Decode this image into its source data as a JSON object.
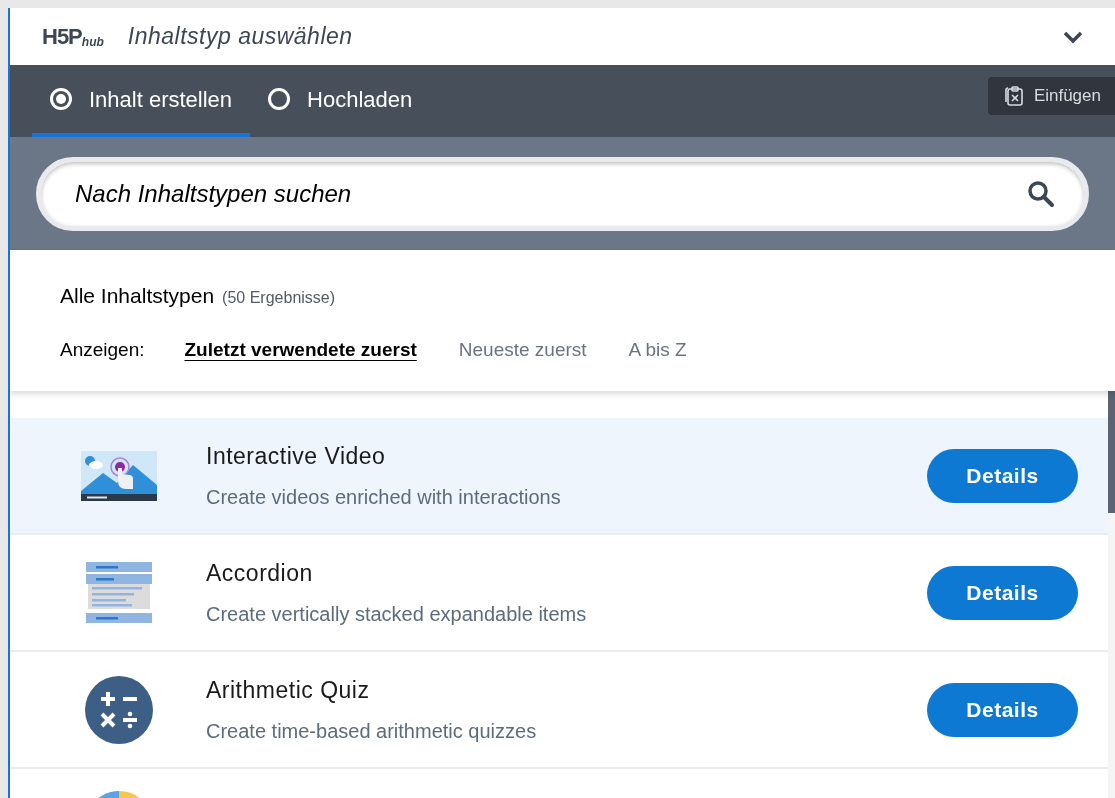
{
  "header": {
    "logo": {
      "main": "H5P",
      "sub": "hub"
    },
    "title": "Inhaltstyp auswählen",
    "expanded": true
  },
  "tabs": [
    {
      "label": "Inhalt erstellen",
      "selected": true
    },
    {
      "label": "Hochladen",
      "selected": false
    }
  ],
  "paste_button": {
    "label": "Einfügen"
  },
  "search": {
    "placeholder": "Nach Inhaltstypen suchen"
  },
  "results": {
    "title": "Alle Inhaltstypen",
    "count": "(50 Ergebnisse)"
  },
  "sort": {
    "label": "Anzeigen:",
    "options": [
      {
        "label": "Zuletzt verwendete zuerst",
        "selected": true
      },
      {
        "label": "Neueste zuerst",
        "selected": false
      },
      {
        "label": "A bis Z",
        "selected": false
      }
    ]
  },
  "items": [
    {
      "kind": "video",
      "title": "Interactive Video",
      "description": "Create videos enriched with interactions",
      "button": "Details",
      "selected": true
    },
    {
      "kind": "accordion",
      "title": "Accordion",
      "description": "Create vertically stacked expandable items",
      "button": "Details",
      "selected": false
    },
    {
      "kind": "arithmetic",
      "title": "Arithmetic Quiz",
      "description": "Create time-based arithmetic quizzes",
      "button": "Details",
      "selected": false
    },
    {
      "kind": "chart",
      "selected": false
    }
  ]
}
